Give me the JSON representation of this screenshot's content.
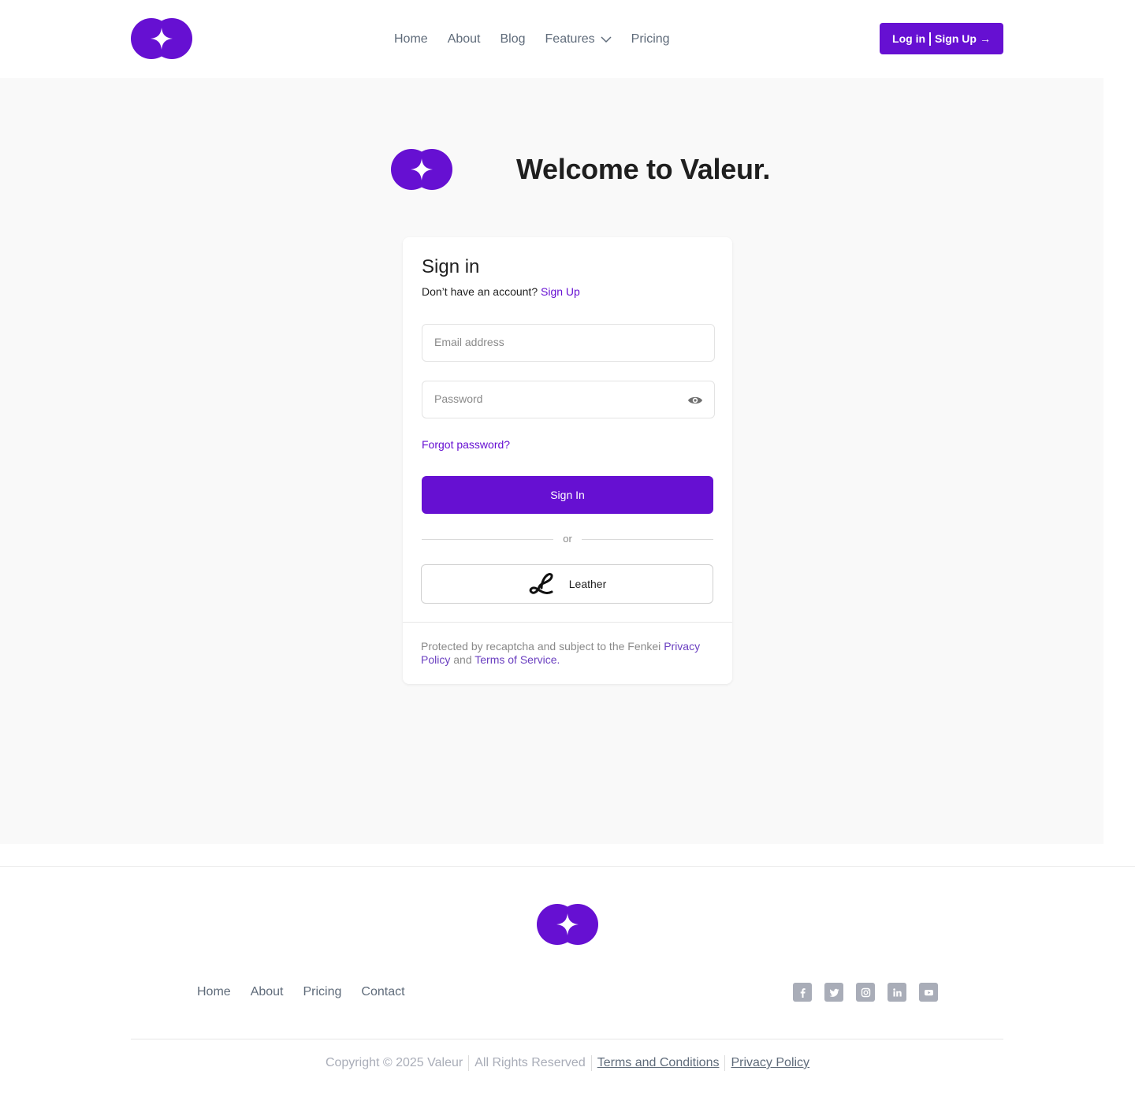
{
  "header": {
    "nav": [
      "Home",
      "About",
      "Blog",
      "Features",
      "Pricing"
    ],
    "cta_login": "Log in",
    "cta_signup": "Sign Up",
    "cta_arrow": "→"
  },
  "hero": {
    "title": "Welcome to Valeur."
  },
  "signin": {
    "title": "Sign in",
    "no_account": "Don’t have an account?",
    "signup_link": "Sign Up",
    "email_placeholder": "Email address",
    "password_placeholder": "Password",
    "forgot": "Forgot password?",
    "submit": "Sign In",
    "or": "or",
    "leather": "Leather",
    "legal_prefix": "Protected by recaptcha and subject to the Fenkei",
    "privacy": "Privacy Policy",
    "and": "and",
    "terms": "Terms of Service."
  },
  "footer": {
    "nav": [
      "Home",
      "About",
      "Pricing",
      "Contact"
    ],
    "social": [
      "facebook-icon",
      "twitter-icon",
      "instagram-icon",
      "linkedin-icon",
      "youtube-icon"
    ],
    "copyright": "Copyright © 2025 Valeur",
    "rights": "All Rights Reserved",
    "terms": "Terms and Conditions",
    "privacy": "Privacy Policy"
  },
  "colors": {
    "brand": "#6610d2",
    "muted": "#5f6b7a",
    "bg": "#f9f9f9"
  }
}
